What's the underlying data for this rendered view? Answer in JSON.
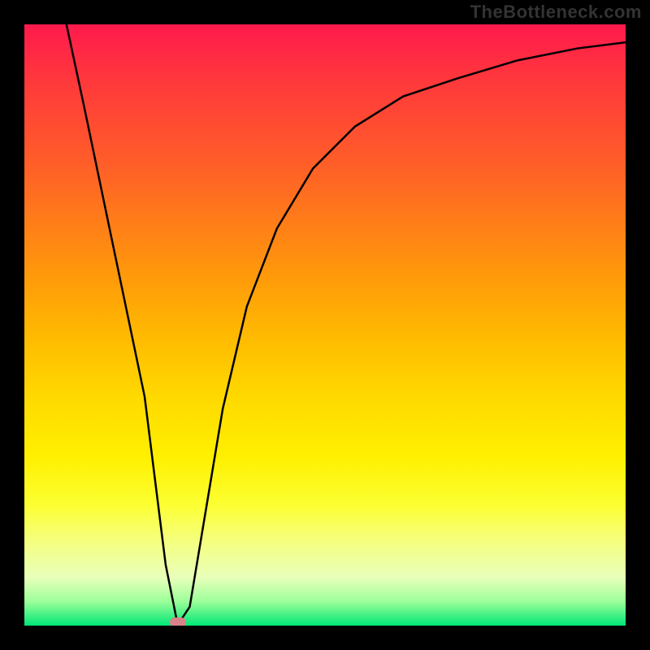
{
  "watermark": "TheBottleneck.com",
  "chart_data": {
    "type": "line",
    "title": "",
    "xlabel": "",
    "ylabel": "",
    "xlim": [
      0,
      1
    ],
    "ylim": [
      0,
      1
    ],
    "background_gradient": {
      "top_color": "#ff1a4d",
      "mid_color": "#ffd900",
      "bottom_color": "#00e676",
      "description": "vertical red-to-orange-to-yellow-to-green"
    },
    "series": [
      {
        "name": "bottleneck-curve",
        "color": "#000000",
        "x": [
          0.07,
          0.1,
          0.15,
          0.2,
          0.235,
          0.255,
          0.275,
          0.3,
          0.33,
          0.37,
          0.42,
          0.48,
          0.55,
          0.63,
          0.72,
          0.82,
          0.92,
          1.0
        ],
        "y": [
          1.0,
          0.86,
          0.62,
          0.38,
          0.1,
          0.0,
          0.03,
          0.18,
          0.36,
          0.53,
          0.66,
          0.76,
          0.83,
          0.88,
          0.91,
          0.94,
          0.96,
          0.97
        ]
      }
    ],
    "marker": {
      "name": "optimal-point",
      "x": 0.255,
      "y": 0.0,
      "color": "#d9818a",
      "shape": "rounded-rect"
    }
  }
}
